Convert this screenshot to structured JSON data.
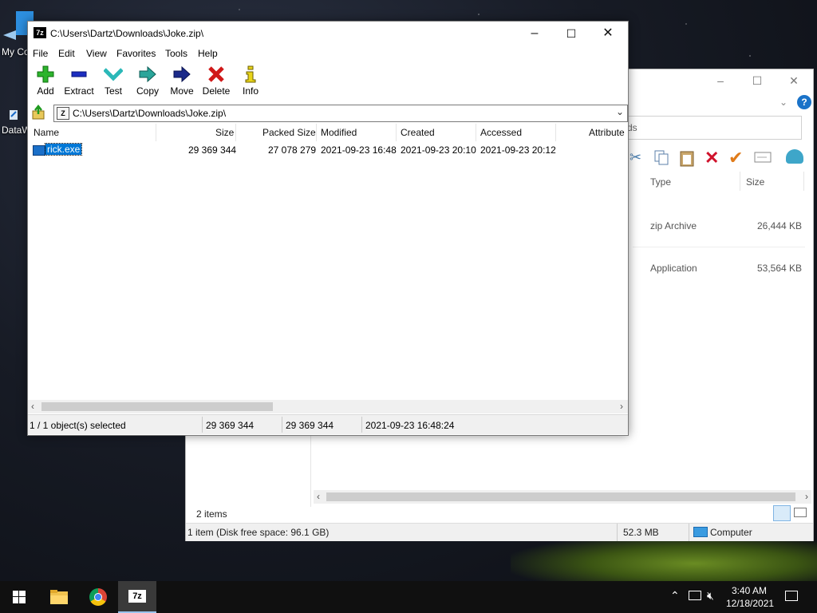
{
  "desktop": {
    "icons": [
      {
        "label": "My Co"
      },
      {
        "label": "DataW"
      }
    ]
  },
  "explorer": {
    "search_partial": "ds",
    "columns": [
      "Type",
      "Size"
    ],
    "rows": [
      {
        "type": "zip Archive",
        "size": "26,444 KB"
      },
      {
        "type": "Application",
        "size": "53,564 KB"
      }
    ],
    "items_count": "2 items",
    "status_left": "1 item (Disk free space: 96.1 GB)",
    "status_size": "52.3 MB",
    "status_location": "Computer"
  },
  "zip": {
    "title": "C:\\Users\\Dartz\\Downloads\\Joke.zip\\",
    "menu": [
      "File",
      "Edit",
      "View",
      "Favorites",
      "Tools",
      "Help"
    ],
    "toolbar": [
      {
        "label": "Add",
        "icon": "add-icon"
      },
      {
        "label": "Extract",
        "icon": "extract-icon"
      },
      {
        "label": "Test",
        "icon": "test-icon"
      },
      {
        "label": "Copy",
        "icon": "copy-icon"
      },
      {
        "label": "Move",
        "icon": "move-icon"
      },
      {
        "label": "Delete",
        "icon": "delete-icon"
      },
      {
        "label": "Info",
        "icon": "info-icon"
      }
    ],
    "address": "C:\\Users\\Dartz\\Downloads\\Joke.zip\\",
    "columns": [
      "Name",
      "Size",
      "Packed Size",
      "Modified",
      "Created",
      "Accessed",
      "Attribute"
    ],
    "files": [
      {
        "name": "rick.exe",
        "size": "29 369 344",
        "packed": "27 078 279",
        "modified": "2021-09-23 16:48",
        "created": "2021-09-23 20:10",
        "accessed": "2021-09-23 20:12"
      }
    ],
    "status": {
      "selected": "1 / 1 object(s) selected",
      "size": "29 369 344",
      "size2": "29 369 344",
      "date": "2021-09-23 16:48:24"
    }
  },
  "taskbar": {
    "time": "3:40 AM",
    "date": "12/18/2021",
    "apps": [
      "start-icon",
      "file-explorer-icon",
      "chrome-icon",
      "7zip-icon"
    ]
  },
  "colors": {
    "selection": "#0078d7",
    "accent": "#0078d7"
  }
}
